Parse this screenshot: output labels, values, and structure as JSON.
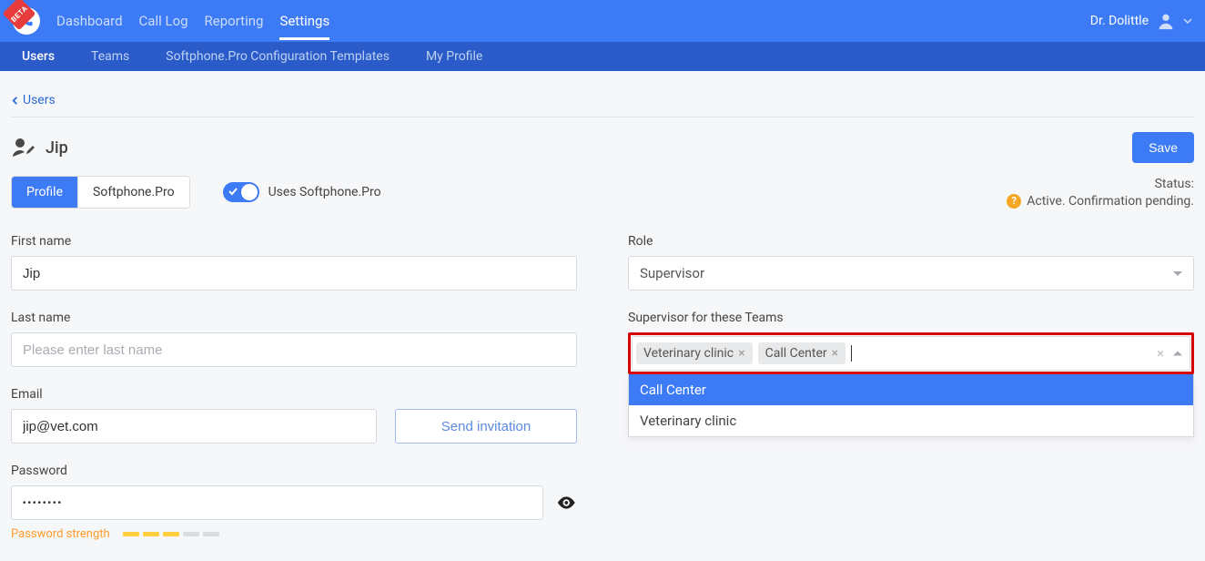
{
  "topnav": {
    "items": [
      "Dashboard",
      "Call Log",
      "Reporting",
      "Settings"
    ],
    "active_index": 3
  },
  "user": {
    "name": "Dr. Dolittle"
  },
  "subnav": {
    "items": [
      "Users",
      "Teams",
      "Softphone.Pro Configuration Templates",
      "My Profile"
    ],
    "active_index": 0
  },
  "breadcrumb": {
    "label": "Users"
  },
  "page_title": "Jip",
  "save_label": "Save",
  "tabs": {
    "items": [
      "Profile",
      "Softphone.Pro"
    ],
    "active_index": 0
  },
  "toggle": {
    "label": "Uses Softphone.Pro",
    "on": true
  },
  "status": {
    "label": "Status:",
    "value": "Active. Confirmation pending."
  },
  "left": {
    "first_name": {
      "label": "First name",
      "value": "Jip"
    },
    "last_name": {
      "label": "Last name",
      "value": "",
      "placeholder": "Please enter last name"
    },
    "email": {
      "label": "Email",
      "value": "jip@vet.com",
      "send_label": "Send invitation"
    },
    "password": {
      "label": "Password",
      "value": "••••••••"
    },
    "strength": {
      "label": "Password strength",
      "level": 3,
      "total": 5
    }
  },
  "right": {
    "role": {
      "label": "Role",
      "value": "Supervisor"
    },
    "teams": {
      "label": "Supervisor for these Teams",
      "selected": [
        "Veterinary clinic",
        "Call Center"
      ],
      "options": [
        "Call Center",
        "Veterinary clinic"
      ],
      "highlighted_index": 0
    }
  }
}
